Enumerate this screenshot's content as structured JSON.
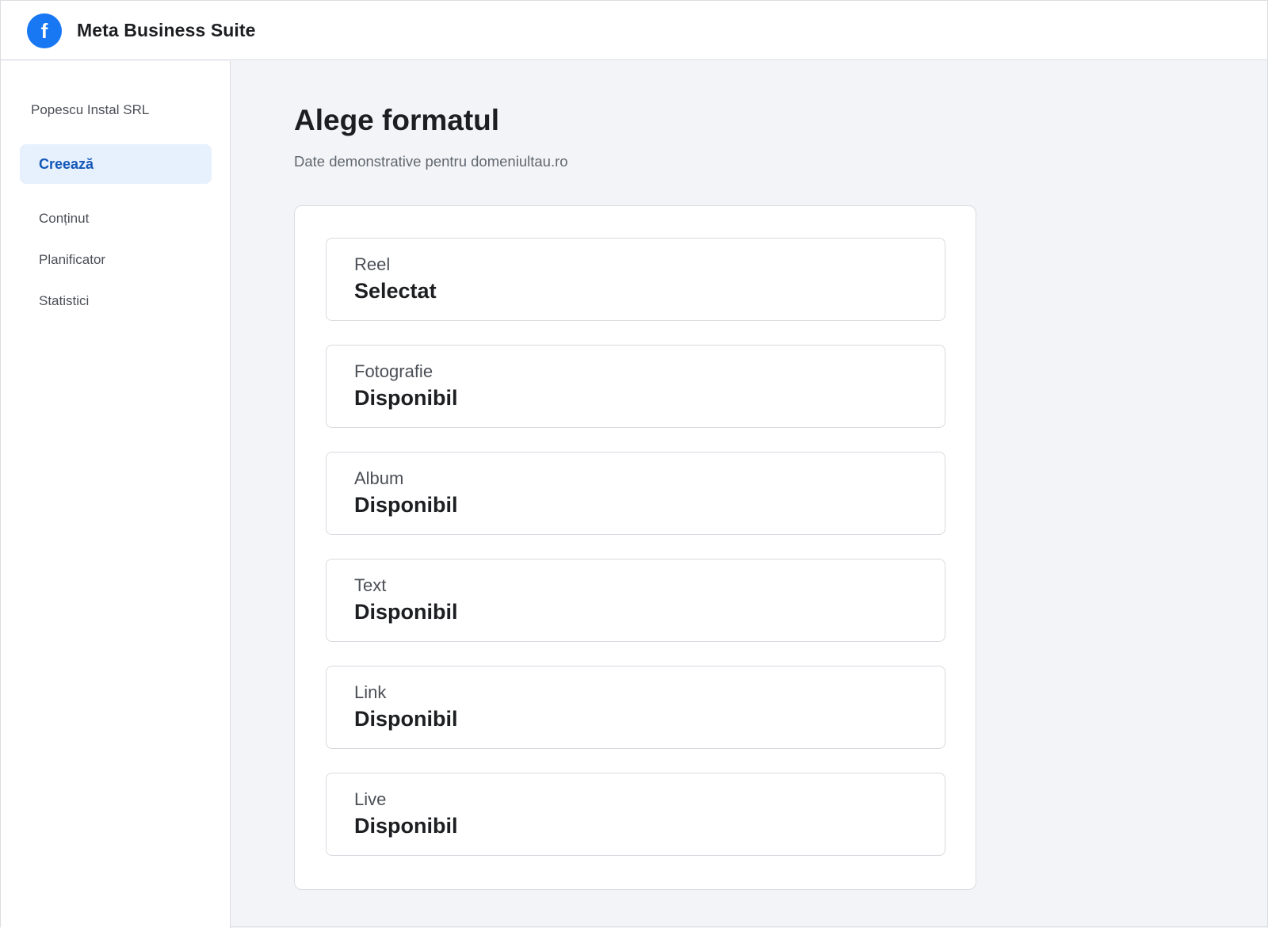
{
  "header": {
    "logo_glyph": "f",
    "app_title": "Meta Business Suite",
    "brand_color": "#1877f2"
  },
  "sidebar": {
    "account_name": "Popescu Instal SRL",
    "items": [
      {
        "label": "Creează",
        "active": true
      },
      {
        "label": "Conținut",
        "active": false
      },
      {
        "label": "Planificator",
        "active": false
      },
      {
        "label": "Statistici",
        "active": false
      }
    ]
  },
  "main": {
    "title": "Alege formatul",
    "subtitle": "Date demonstrative pentru domeniultau.ro",
    "formats": [
      {
        "name": "Reel",
        "status": "Selectat"
      },
      {
        "name": "Fotografie",
        "status": "Disponibil"
      },
      {
        "name": "Album",
        "status": "Disponibil"
      },
      {
        "name": "Text",
        "status": "Disponibil"
      },
      {
        "name": "Link",
        "status": "Disponibil"
      },
      {
        "name": "Live",
        "status": "Disponibil"
      }
    ]
  }
}
